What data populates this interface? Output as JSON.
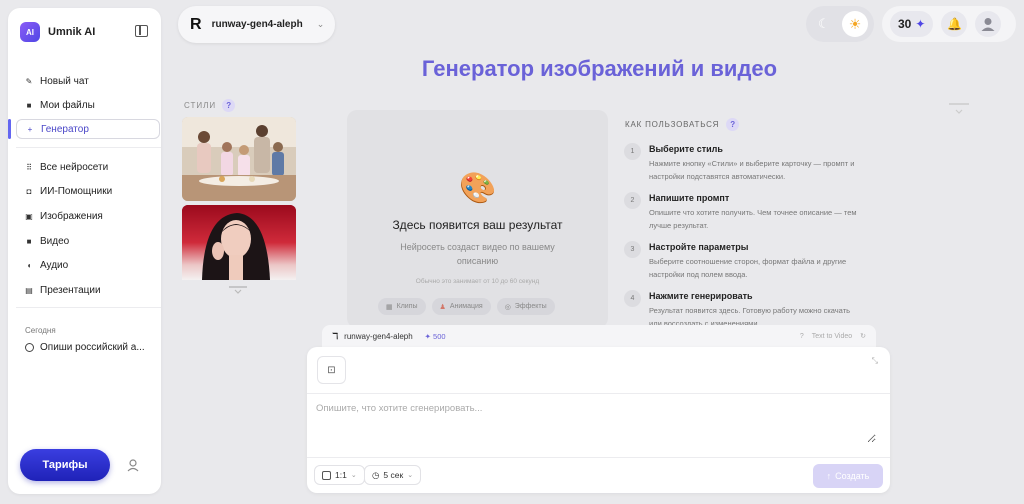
{
  "app": {
    "name": "Umnik AI",
    "logo_text": "AI"
  },
  "sidebar": {
    "items": [
      {
        "label": "Новый чат",
        "icon": "pencil-icon"
      },
      {
        "label": "Мои файлы",
        "icon": "folder-icon"
      },
      {
        "label": "Генератор",
        "icon": "plus-icon",
        "active": true
      },
      {
        "label": "Все нейросети",
        "icon": "grid-icon"
      },
      {
        "label": "ИИ-Помощники",
        "icon": "robot-icon"
      },
      {
        "label": "Изображения",
        "icon": "image-icon"
      },
      {
        "label": "Видео",
        "icon": "video-icon"
      },
      {
        "label": "Аудио",
        "icon": "audio-icon"
      },
      {
        "label": "Презентации",
        "icon": "presentation-icon"
      }
    ],
    "section_today": "Сегодня",
    "recent_chat": "Опиши российский а...",
    "tariffs_label": "Тарифы"
  },
  "model_selector": {
    "name": "runway-gen4-aleph"
  },
  "header": {
    "credits": "30"
  },
  "page_title": "Генератор изображений и видео",
  "styles": {
    "label": "СТИЛИ"
  },
  "result": {
    "title": "Здесь появится ваш результат",
    "subtitle": "Нейросеть создаст видео по вашему описанию",
    "hint": "Обычно это занимает от 10 до 60 секунд",
    "chips": [
      "Клипы",
      "Анимация",
      "Эффекты"
    ]
  },
  "how_to": {
    "title": "КАК ПОЛЬЗОВАТЬСЯ",
    "steps": [
      {
        "num": "1",
        "title": "Выберите стиль",
        "desc": "Нажмите кнопку «Стили» и выберите карточку — промпт и настройки подставятся автоматически."
      },
      {
        "num": "2",
        "title": "Напишите промпт",
        "desc": "Опишите что хотите получить. Чем точнее описание — тем лучше результат."
      },
      {
        "num": "3",
        "title": "Настройте параметры",
        "desc": "Выберите соотношение сторон, формат файла и другие настройки под полем ввода."
      },
      {
        "num": "4",
        "title": "Нажмите генерировать",
        "desc": "Результат появится здесь. Готовую работу можно скачать или воссоздать с изменениями."
      }
    ]
  },
  "composer": {
    "model_name": "runway-gen4-aleph",
    "cost": "500",
    "mode": "Text to Video",
    "placeholder": "Опишите, что хотите сгенерировать...",
    "aspect": "1:1",
    "duration": "5 сек",
    "create_label": "Создать"
  },
  "colors": {
    "accent": "#4f46e5",
    "title": "#6a62d8",
    "tariffs": "#2a2ed0"
  }
}
